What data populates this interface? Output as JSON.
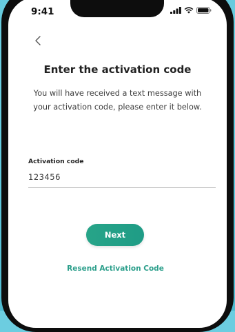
{
  "status_bar": {
    "time": "9:41"
  },
  "colors": {
    "accent": "#27a488",
    "link": "#2a9e8a",
    "background": "#6ccde0"
  },
  "header": {
    "back_icon": "chevron-left-icon"
  },
  "main": {
    "title": "Enter the activation code",
    "subtitle_line1": "You will have received a text message with",
    "subtitle_line2": "your activation code, please enter it below."
  },
  "form": {
    "field_label": "Activation code",
    "field_value": "123456"
  },
  "actions": {
    "next_label": "Next",
    "resend_label": "Resend Activation Code"
  }
}
